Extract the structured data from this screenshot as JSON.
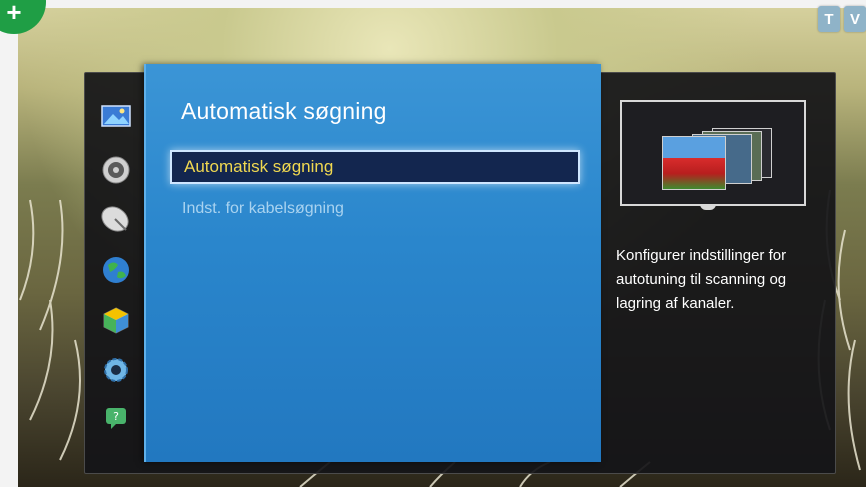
{
  "tv_buttons": [
    "T",
    "V"
  ],
  "corner_badge": "+",
  "sidebar": {
    "items": [
      {
        "name": "picture",
        "icon": "picture-icon",
        "color": "#3a7bd5"
      },
      {
        "name": "sound",
        "icon": "speaker-icon",
        "color": "#9a9a9a"
      },
      {
        "name": "broadcast",
        "icon": "satellite-dish-icon",
        "color": "#bfbfbf"
      },
      {
        "name": "network",
        "icon": "globe-icon",
        "color": "#2e9f4a"
      },
      {
        "name": "system",
        "icon": "cube-icon",
        "color": "#e0b400"
      },
      {
        "name": "support",
        "icon": "gear-icon",
        "color": "#6fb6e6"
      },
      {
        "name": "help",
        "icon": "help-icon",
        "color": "#49b36b"
      }
    ]
  },
  "panel": {
    "title": "Automatisk søgning",
    "items": [
      {
        "label": "Automatisk søgning",
        "selected": true
      },
      {
        "label": "Indst. for kabelsøgning",
        "selected": false
      }
    ]
  },
  "info": {
    "description": "Konfigurer indstillinger for autotuning til scanning og lagring af kanaler."
  },
  "colors": {
    "panel_blue": "#2a86cc",
    "selection_bg": "#13264f",
    "selection_text": "#f0d850",
    "dimmed_text": "#a9d3f0"
  }
}
